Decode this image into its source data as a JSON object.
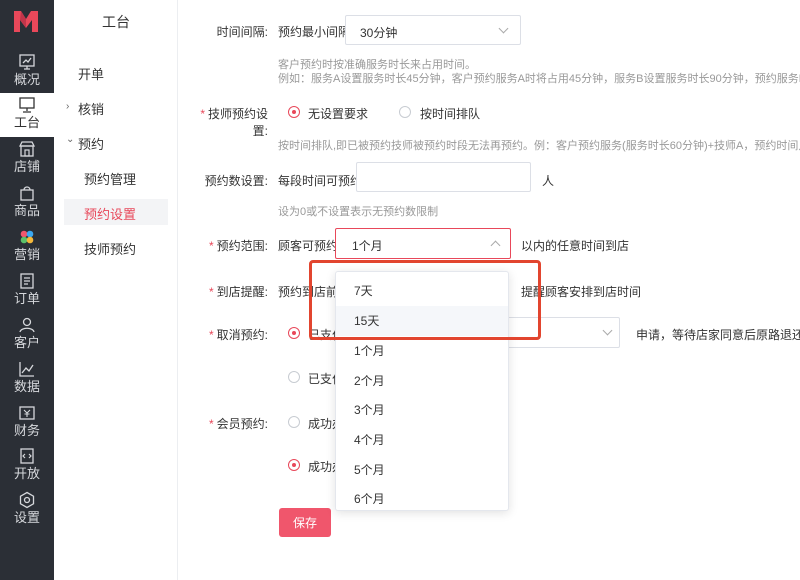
{
  "rail": {
    "items": [
      {
        "label": "概况",
        "icon": "chart-board-icon"
      },
      {
        "label": "工台",
        "icon": "monitor-icon"
      },
      {
        "label": "店铺",
        "icon": "store-icon"
      },
      {
        "label": "商品",
        "icon": "bag-icon"
      },
      {
        "label": "营销",
        "icon": "flower-icon"
      },
      {
        "label": "订单",
        "icon": "receipt-icon"
      },
      {
        "label": "客户",
        "icon": "user-icon"
      },
      {
        "label": "数据",
        "icon": "line-chart-icon"
      },
      {
        "label": "财务",
        "icon": "wallet-icon"
      },
      {
        "label": "开放",
        "icon": "code-icon"
      },
      {
        "label": "设置",
        "icon": "gear-icon"
      }
    ]
  },
  "subnav": {
    "title": "工台",
    "kaidan": "开单",
    "hexiao": "核销",
    "yuyue": "预约",
    "yuyue_manage": "预约管理",
    "yuyue_settings": "预约设置",
    "tech_booking": "技师预约"
  },
  "form": {
    "interval": {
      "label": "时间间隔:",
      "prefix": "预约最小间隔",
      "value": "30分钟",
      "hint1": "客户预约时按准确服务时长来占用时间。",
      "hint2": "例如：服务A设置服务时长45分钟，客户预约服务A时将占用45分钟，服务B设置服务时长90分钟，预约服务B时将"
    },
    "tech": {
      "label": "技师预约设置:",
      "opt1": "无设置要求",
      "opt2": "按时间排队",
      "hint": "按时间排队,即已被预约技师被预约时段无法再预约。例：客户预约服务(服务时长60分钟)+技师A，预约时间点"
    },
    "count": {
      "label": "预约数设置:",
      "prefix": "每段时间可预约",
      "suffix": "人",
      "value": "",
      "hint": "设为0或不设置表示无预约数限制"
    },
    "range": {
      "label": "预约范围:",
      "prefix": "顾客可预约",
      "value": "1个月",
      "suffix": "以内的任意时间到店"
    },
    "remind": {
      "label": "到店提醒:",
      "prefix": "预约到店前",
      "suffix": "提醒顾客安排到店时间"
    },
    "cancel": {
      "label": "取消预约:",
      "opt1": "已支付",
      "opt2": "已支付",
      "suffix": "申请，等待店家同意后原路退还"
    },
    "member": {
      "label": "会员预约:",
      "opt1": "成功办",
      "opt2": "成功办"
    }
  },
  "dropdown": {
    "options": [
      "7天",
      "15天",
      "1个月",
      "2个月",
      "3个月",
      "4个月",
      "5个月",
      "6个月"
    ],
    "hovered_index": 1
  },
  "save_label": "保存",
  "colors": {
    "accent": "#e8485a",
    "rail_bg": "#2b2f36",
    "highlight": "#e2452f"
  }
}
